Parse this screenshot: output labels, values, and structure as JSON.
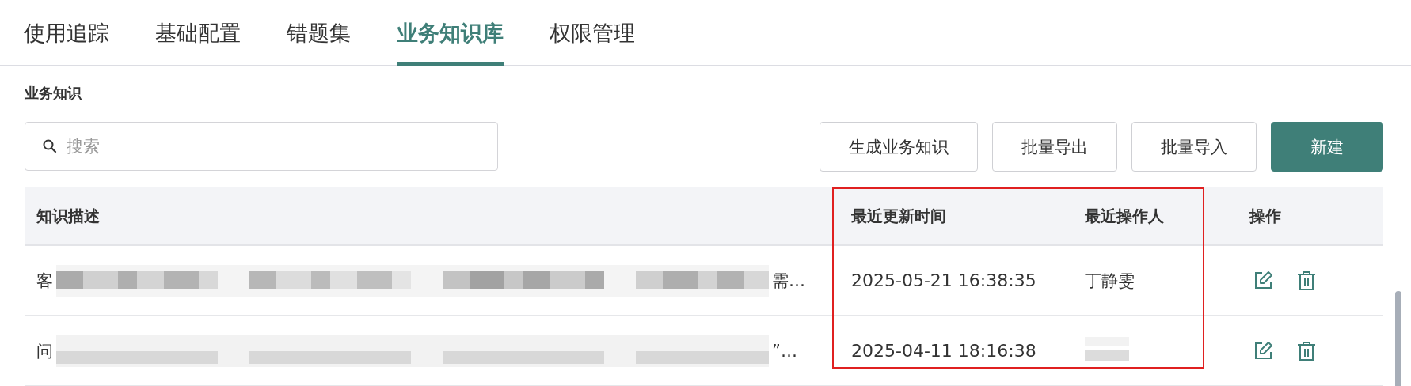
{
  "tabs": [
    {
      "label": "使用追踪",
      "selected": false
    },
    {
      "label": "基础配置",
      "selected": false
    },
    {
      "label": "错题集",
      "selected": false
    },
    {
      "label": "业务知识库",
      "selected": true
    },
    {
      "label": "权限管理",
      "selected": false
    }
  ],
  "section_title": "业务知识",
  "search": {
    "placeholder": "搜索"
  },
  "buttons": [
    {
      "label": "生成业务知识",
      "kind": "outline"
    },
    {
      "label": "批量导出",
      "kind": "outline"
    },
    {
      "label": "批量导入",
      "kind": "outline"
    },
    {
      "label": "新建",
      "kind": "primary"
    }
  ],
  "table": {
    "columns": [
      "知识描述",
      "最近更新时间",
      "最近操作人",
      "操作"
    ],
    "rows": [
      {
        "description_start": "客",
        "description_end": "需…",
        "updated": "2025-05-21 16:38:35",
        "operator": "丁静雯"
      },
      {
        "description_start": "问",
        "description_end": "”…",
        "updated": "2025-04-11 18:16:38"
      }
    ]
  }
}
